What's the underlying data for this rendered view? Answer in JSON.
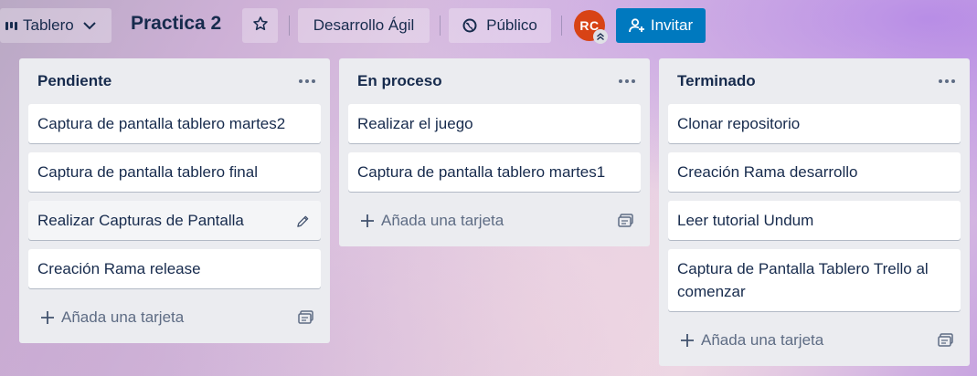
{
  "header": {
    "view_label": "Tablero",
    "board_title": "Practica 2",
    "team_label": "Desarrollo Ágil",
    "visibility_label": "Público",
    "avatar_initials": "RC",
    "invite_label": "Invitar",
    "colors": {
      "invite": "#0079bf",
      "avatar": "#d84315"
    }
  },
  "lists": [
    {
      "title": "Pendiente",
      "cards": [
        "Captura de pantalla tablero martes2",
        "Captura de pantalla tablero final",
        "Realizar Capturas de Pantalla",
        "Creación Rama release"
      ],
      "hovered_card": 2,
      "add_label": "Añada una tarjeta"
    },
    {
      "title": "En proceso",
      "cards": [
        "Realizar el juego",
        "Captura de pantalla tablero martes1"
      ],
      "add_label": "Añada una tarjeta"
    },
    {
      "title": "Terminado",
      "cards": [
        "Clonar repositorio",
        "Creación Rama desarrollo",
        "Leer tutorial Undum",
        "Captura de Pantalla Tablero Trello al comenzar"
      ],
      "add_label": "Añada una tarjeta"
    }
  ]
}
